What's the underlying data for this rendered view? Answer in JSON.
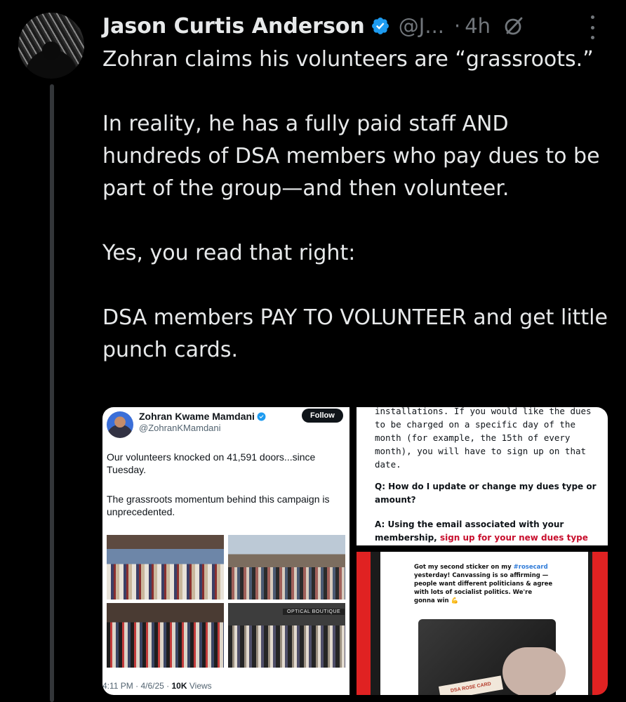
{
  "tweet": {
    "author_name": "Jason Curtis Anderson",
    "author_handle": "@J...",
    "separator": "·",
    "time": "4h",
    "paragraphs": [
      "Zohran claims his volunteers are “grassroots.”",
      "In reality, he has a fully paid staff AND hundreds of DSA members who pay dues to be part of the group—and then volunteer.",
      "Yes, you read that right:",
      "DSA members PAY TO VOLUNTEER and get little punch cards."
    ]
  },
  "embedded_tweet": {
    "name": "Zohran Kwame Mamdani",
    "handle": "@ZohranKMamdani",
    "follow_label": "Follow",
    "text1": "Our volunteers knocked on 41,591 doors...since Tuesday.",
    "text2": "The grassroots momentum behind this campaign is unprecedented.",
    "store_sign": "OPTICAL BOUTIQUE",
    "meta_time": "4:11 PM · 4/6/25 ·",
    "meta_views": "10K",
    "meta_views_label": "Views"
  },
  "faq": {
    "line1": "installations. If you would like the dues to be charged on a specific day of the month (for example, the 15th of every month), you will have to sign up on that date.",
    "question": "Q: How do I update or change my dues type or amount?",
    "answer": "A: Using the email associated with your membership,",
    "link": "sign up for your new dues type"
  },
  "rosecard_post": {
    "text_before": "Got my second sticker on my",
    "hashtag": "#rosecard",
    "text_after": "yesterday! Canvassing is so affirming — people want different politicians & agree with lots of socialist politics. We're gonna win",
    "card_text": "DSA ROSE CARD"
  },
  "colors": {
    "background": "#000000",
    "text_primary": "#e7e9ea",
    "text_secondary": "#71767b",
    "verified_blue": "#1d9bf0",
    "accent_red": "#e02222"
  },
  "icons": [
    "verified-icon",
    "grok-icon",
    "more-icon"
  ]
}
